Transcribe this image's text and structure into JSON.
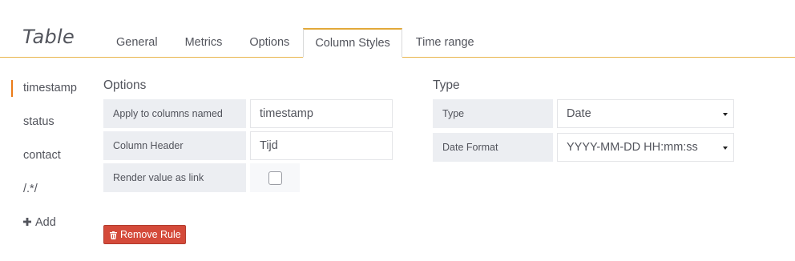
{
  "panel": {
    "title": "Table"
  },
  "tabs": [
    {
      "label": "General"
    },
    {
      "label": "Metrics"
    },
    {
      "label": "Options"
    },
    {
      "label": "Column Styles",
      "active": true
    },
    {
      "label": "Time range"
    }
  ],
  "sidebar": {
    "items": [
      {
        "label": "timestamp",
        "active": true
      },
      {
        "label": "status"
      },
      {
        "label": "contact"
      },
      {
        "label": "/.*/"
      }
    ],
    "add_label": "Add",
    "add_icon": "plus-icon"
  },
  "options": {
    "title": "Options",
    "apply_label": "Apply to columns named",
    "apply_value": "timestamp",
    "header_label": "Column Header",
    "header_value": "Tijd",
    "link_label": "Render value as link",
    "link_checked": false
  },
  "type_section": {
    "title": "Type",
    "type_label": "Type",
    "type_value": "Date",
    "format_label": "Date Format",
    "format_value": "YYYY-MM-DD HH:mm:ss"
  },
  "remove_button": {
    "label": "Remove Rule",
    "icon": "trash-icon"
  },
  "colors": {
    "accent": "#e8b44c",
    "active_marker": "#eb7b18",
    "danger": "#d44a3a",
    "label_bg": "#eceef2"
  }
}
